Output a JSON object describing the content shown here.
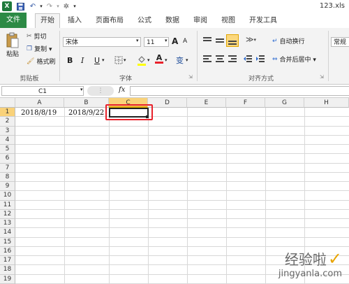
{
  "title": "123.xls",
  "quick_access": {
    "icons": [
      "excel-logo",
      "save-icon",
      "undo-icon",
      "redo-icon",
      "customize-icon"
    ],
    "logo_letter": "X"
  },
  "tabs": [
    "文件",
    "开始",
    "插入",
    "页面布局",
    "公式",
    "数据",
    "审阅",
    "视图",
    "开发工具"
  ],
  "active_tab": "开始",
  "clipboard": {
    "paste": "粘贴",
    "cut": "剪切",
    "copy": "复制 ▾",
    "format_painter": "格式刷",
    "group": "剪贴板"
  },
  "font": {
    "name": "宋体",
    "size": "11",
    "bold": "B",
    "italic": "I",
    "underline": "U",
    "underline_arrow": "▾",
    "grow": "A",
    "shrink": "A",
    "phonetic": "变",
    "color_letter": "A",
    "group": "字体"
  },
  "alignment": {
    "wrap": "自动换行",
    "merge": "合并后居中 ▾",
    "group": "对齐方式"
  },
  "number": {
    "format": "常规"
  },
  "formula_bar": {
    "name_box": "C1",
    "fx": "fx",
    "value": ""
  },
  "columns": [
    "A",
    "B",
    "C",
    "D",
    "E",
    "F",
    "G",
    "H"
  ],
  "rows": [
    "1",
    "2",
    "3",
    "4",
    "5",
    "6",
    "7",
    "8",
    "9",
    "10",
    "11",
    "12",
    "13",
    "14",
    "15",
    "16",
    "17",
    "18",
    "19"
  ],
  "cells": {
    "A1": "2018/8/19",
    "B1": "2018/9/22"
  },
  "selected_cell": "C1",
  "watermark": {
    "text": "经验啦",
    "url": "jingyanla.com"
  },
  "colors": {
    "file_tab": "#2c8a45",
    "selection": "#f9d27a",
    "highlight_box": "#e8212b"
  }
}
